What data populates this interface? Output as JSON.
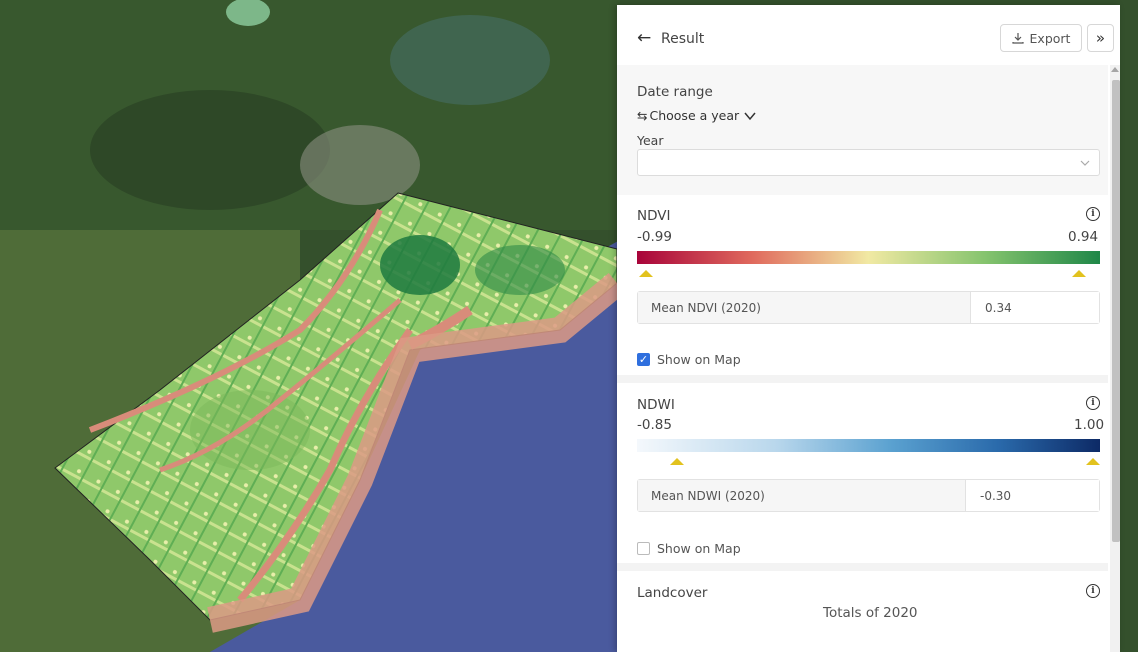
{
  "header": {
    "title": "Result",
    "export_label": "Export"
  },
  "date_range": {
    "title": "Date range",
    "mode_label": "Choose a year",
    "year_label": "Year",
    "year_value": ""
  },
  "ndvi": {
    "title": "NDVI",
    "min": "-0.99",
    "max": "0.94",
    "mean_label": "Mean NDVI (2020)",
    "mean_value": "0.34",
    "show_on_map_label": "Show on Map",
    "show_on_map": true,
    "gradient_colors": [
      "#a8043a",
      "#f1e9a3",
      "#1f8748"
    ]
  },
  "ndwi": {
    "title": "NDWI",
    "min": "-0.85",
    "max": "1.00",
    "mean_label": "Mean NDWI (2020)",
    "mean_value": "-0.30",
    "show_on_map_label": "Show on Map",
    "show_on_map": false,
    "gradient_colors": [
      "#f4f8fc",
      "#5aa1d0",
      "#0d2a66"
    ]
  },
  "landcover": {
    "title": "Landcover",
    "subtitle": "Totals of 2020"
  },
  "colors": {
    "accent": "#2f6fde",
    "marker": "#e2c21e",
    "sea": "#4a5a9e",
    "land": "#3d5a2f"
  },
  "icons": [
    "arrow-left-icon",
    "download-icon",
    "double-chevron-right-icon",
    "swap-icon",
    "chevron-down-icon",
    "info-icon",
    "check-icon"
  ]
}
